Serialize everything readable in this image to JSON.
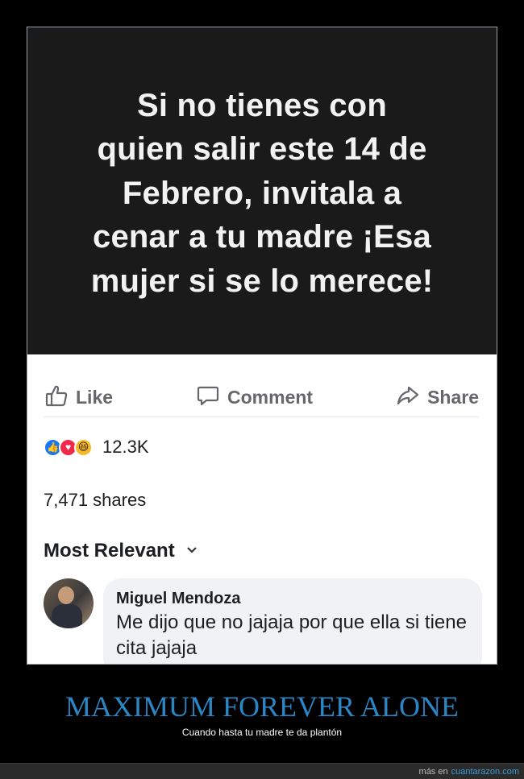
{
  "post": {
    "image_text": "Si no tienes con\nquien salir este 14 de\nFebrero, invitala a\ncenar a tu madre ¡Esa\nmujer si se lo merece!"
  },
  "actions": {
    "like": "Like",
    "comment": "Comment",
    "share": "Share"
  },
  "reactions": {
    "count": "12.3K",
    "icons": [
      "like-reaction",
      "love-reaction",
      "haha-reaction"
    ]
  },
  "shares": "7,471 shares",
  "sort": {
    "label": "Most Relevant",
    "icon": "chevron-down-icon"
  },
  "comment": {
    "name": "Miguel Mendoza",
    "text": "Me dijo que no jajaja por que ella si tiene cita jajaja"
  },
  "caption": {
    "title": "MAXIMUM FOREVER ALONE",
    "subtitle": "Cuando hasta tu madre te da plantón"
  },
  "footer": {
    "prefix": "más en",
    "site": "cuantarazon.com"
  },
  "colors": {
    "caption": "#2b86c5",
    "facebook_blue": "#1877f2",
    "love_red": "#f0284a",
    "haha_yellow": "#f7b928"
  }
}
